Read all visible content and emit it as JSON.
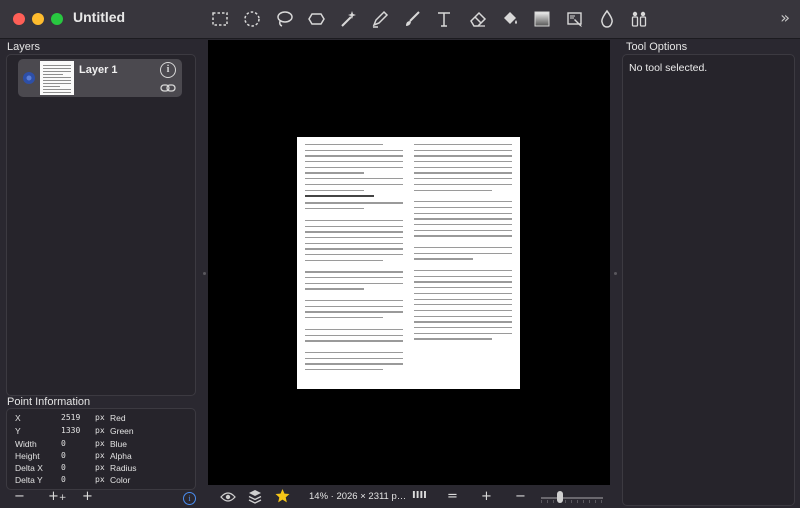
{
  "window": {
    "title": "Untitled",
    "more_icon": "chevron-double-right-icon"
  },
  "toolbar": {
    "tools": [
      {
        "name": "rect-select-tool",
        "icon": "dashed-rectangle-icon"
      },
      {
        "name": "ellipse-select-tool",
        "icon": "dashed-circle-icon"
      },
      {
        "name": "lasso-tool",
        "icon": "lasso-icon"
      },
      {
        "name": "polygon-select-tool",
        "icon": "polygon-icon"
      },
      {
        "name": "magic-wand-tool",
        "icon": "magic-wand-icon"
      },
      {
        "name": "pen-tool",
        "icon": "pen-icon"
      },
      {
        "name": "brush-tool",
        "icon": "brush-icon"
      },
      {
        "name": "text-tool",
        "icon": "text-T-icon"
      },
      {
        "name": "eraser-tool",
        "icon": "eraser-icon"
      },
      {
        "name": "fill-tool",
        "icon": "paint-bucket-icon"
      },
      {
        "name": "gradient-tool",
        "icon": "gradient-square-icon"
      },
      {
        "name": "color-picker-tool",
        "icon": "eyedropper-icon"
      },
      {
        "name": "blur-tool",
        "icon": "drop-icon"
      },
      {
        "name": "clone-tool",
        "icon": "stamp-icon"
      }
    ]
  },
  "layers": {
    "title": "Layers",
    "items": [
      {
        "name": "Layer 1"
      }
    ]
  },
  "point_info": {
    "title": "Point Information",
    "rows": [
      {
        "key": "X",
        "value": "2519",
        "unit": "px",
        "channel": "Red"
      },
      {
        "key": "Y",
        "value": "1330",
        "unit": "px",
        "channel": "Green"
      },
      {
        "key": "Width",
        "value": "0",
        "unit": "px",
        "channel": "Blue"
      },
      {
        "key": "Height",
        "value": "0",
        "unit": "px",
        "channel": "Alpha"
      },
      {
        "key": "Delta X",
        "value": "0",
        "unit": "px",
        "channel": "Radius"
      },
      {
        "key": "Delta Y",
        "value": "0",
        "unit": "px",
        "channel": "Color"
      }
    ]
  },
  "left_bottom": {
    "remove": "−",
    "duplicate": "+",
    "add": "+"
  },
  "canvas_bar": {
    "zoom_text": "14% · 2026 × 2311 p…",
    "columns_label": "IIII",
    "equal_label": "=",
    "plus_label": "+",
    "minus_label": "−"
  },
  "tool_options": {
    "title": "Tool Options",
    "message": "No tool selected."
  },
  "colors": {
    "accent": "#4a8df0",
    "star": "#f5c518"
  }
}
